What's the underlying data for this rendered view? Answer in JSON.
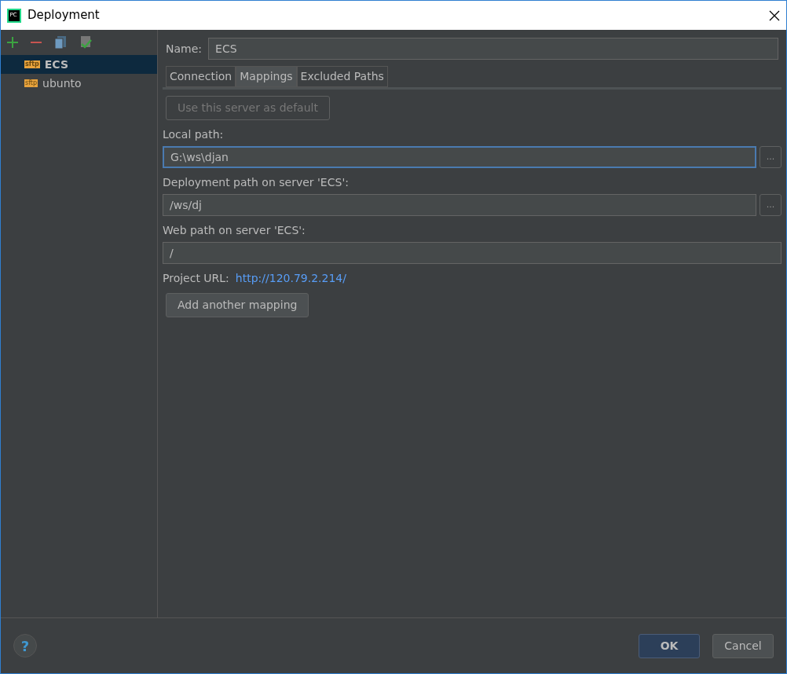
{
  "window": {
    "title": "Deployment",
    "logo": "PC"
  },
  "servers": [
    {
      "label": "ECS",
      "badge": "sftp",
      "selected": true
    },
    {
      "label": "ubunto",
      "badge": "sftp",
      "selected": false
    }
  ],
  "name_field": {
    "label": "Name:",
    "value": "ECS"
  },
  "tabs": [
    {
      "label": "Connection",
      "selected": false
    },
    {
      "label": "Mappings",
      "selected": true
    },
    {
      "label": "Excluded Paths",
      "selected": false
    }
  ],
  "default_button": {
    "label": "Use this server as default",
    "disabled": true
  },
  "fields": [
    {
      "label": "Local path:",
      "value": "G:\\ws\\djan",
      "focused": true,
      "browse": "..."
    },
    {
      "label": "Deployment path on server 'ECS':",
      "value": "/ws/dj",
      "focused": false,
      "browse": "..."
    },
    {
      "label": "Web path on server 'ECS':",
      "value": "/",
      "focused": false
    }
  ],
  "project_url": {
    "label": "Project URL:",
    "link": "http://120.79.2.214/"
  },
  "add_mapping_button": "Add another mapping",
  "help": "?",
  "buttons": [
    {
      "label": "OK",
      "kind": "primary"
    },
    {
      "label": "Cancel",
      "kind": "secondary"
    }
  ]
}
